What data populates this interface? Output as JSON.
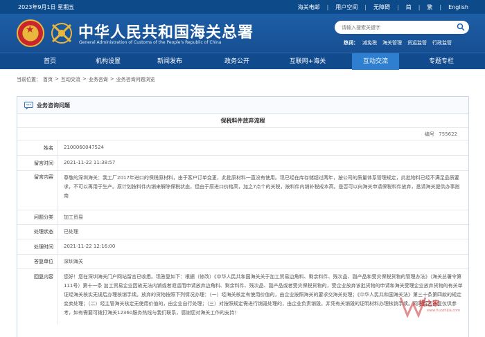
{
  "topbar": {
    "date": "2023年9月1日 星期五",
    "links": [
      "海关电邮",
      "用户空间",
      "无障碍",
      "简",
      "繁",
      "English"
    ]
  },
  "header": {
    "title_cn": "中华人民共和国海关总署",
    "title_en": "General Administration of Customs of the People's Republic of China",
    "search_placeholder": "请输入搜索关键字",
    "hot_label": "热词：",
    "hot_words": [
      "减免税",
      "海关管理",
      "货运监管",
      "行政监管"
    ]
  },
  "nav": {
    "items": [
      "首页",
      "机构设置",
      "新闻发布",
      "政务公开",
      "互联网+海关",
      "互动交流",
      "专题专栏"
    ],
    "active_index": 5
  },
  "breadcrumb": [
    "当前位置：",
    "首页",
    ">",
    "互动交流",
    ">",
    "业务咨询",
    ">",
    "业务咨询问题浏览"
  ],
  "panel": {
    "title": "业务咨询问题",
    "doc_title": "保税料件放弃流程",
    "serial_label": "编号",
    "serial_value": "755622",
    "rows": [
      {
        "label": "姓名",
        "value": "2100060047524"
      },
      {
        "label": "留言时间",
        "value": "2021-11-22 11:38:57"
      },
      {
        "label": "留言内容",
        "value": "尊敬的深圳海关：我工厂2017年进口的保税原材料，由于客户订单变更，此批原材料一直没有使用。现已经在库存储超过两年，按公司的质量体系管理规定，此批物料已经不满足品质要求，不可以再用于生产。原计划按料件内销来解除保税状态，但由于原进口价格高，加之7点个的关税，按料件内销补税成本高。是否可以向海关申请保税料件放弃，恳请海关提供办事指南"
      },
      {
        "label": "问题分类",
        "value": "加工贸易"
      },
      {
        "label": "处理状态",
        "value": "已处理"
      },
      {
        "label": "处理时间",
        "value": "2021-11-22 12:16:00"
      },
      {
        "label": "答复单位",
        "value": "深圳海关"
      },
      {
        "label": "回复内容",
        "value": "您好！您在深圳海关门户网站留言已收悉。现答复如下：根据（修改）《中华人民共和国海关关于加工贸易边角料、剩余料件、残次品、副产品和受灾保税货物的管理办法》（海关总署令第111号）第十一条 加工贸易企业因故无法内销或者退运而申请放弃边角料、剩余料件、残次品、副产品或者受灾保税货物的，受企业放弃该批货物的申请和海关受理企业放弃货物的有关单证经海关核实无误后办理核销手续。放弃的货物按照下列情况办理：（一）经海关核定有使用价值的，由企业按照海关的要求交海关处理；《中华人民共和国海关法》第三十条第四款的规定变卖处理；（二）经主管海关核定无使用价值的，由企业自行处理；（三）对按照规定需进行销毁处理的，由企业负责销毁，并凭有关销毁的证明材料办理核销手续。网站留言答复仅供参考，如有需要可拨打海关12360服务热线与我们联系，感谢您对海关工作的支持！"
      }
    ]
  },
  "watermark": {
    "text": "货之家",
    "url": "www.huozhijia.com"
  }
}
